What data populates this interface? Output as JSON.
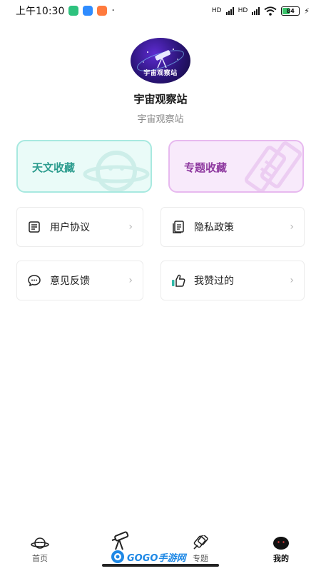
{
  "status_bar": {
    "time": "上午10:30",
    "network_1": "HD",
    "network_2": "HD",
    "battery": "84"
  },
  "profile": {
    "avatar_text": "宇宙观察站",
    "name": "宇宙观察站",
    "subtitle": "宇宙观察站"
  },
  "collections": [
    {
      "label": "天文收藏",
      "icon": "planet-icon",
      "color": "#2c9c8e"
    },
    {
      "label": "专题收藏",
      "icon": "tiles-icon",
      "color": "#8f3aa0"
    }
  ],
  "menu": [
    {
      "label": "用户协议",
      "icon": "agreement-icon"
    },
    {
      "label": "隐私政策",
      "icon": "document-icon"
    },
    {
      "label": "意见反馈",
      "icon": "chat-bubble-icon"
    },
    {
      "label": "我赞过的",
      "icon": "thumbs-up-icon"
    }
  ],
  "bottom_nav": [
    {
      "label": "首页",
      "icon": "planet-icon"
    },
    {
      "label": "",
      "icon": "telescope-icon"
    },
    {
      "label": "专题",
      "icon": "rocket-icon"
    },
    {
      "label": "我的",
      "icon": "avatar-icon",
      "active": true
    }
  ],
  "watermark": {
    "text": "GOGO手游网"
  }
}
